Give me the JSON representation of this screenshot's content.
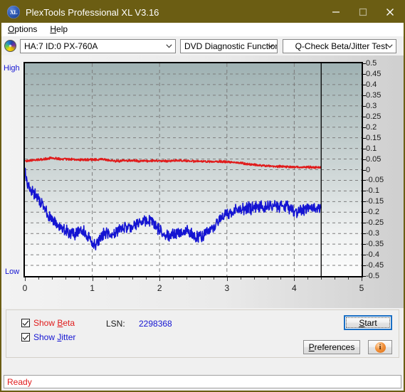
{
  "window": {
    "title": "PlexTools Professional XL V3.16",
    "app_icon": "xl-disc-icon",
    "minimize_label": "minimize-icon",
    "maximize_label": "maximize-icon",
    "close_label": "close-icon",
    "titlebar_color": "#6b5d13"
  },
  "menu": {
    "items": [
      {
        "label": "Options",
        "accel": "O"
      },
      {
        "label": "Help",
        "accel": "H"
      }
    ]
  },
  "toolbar": {
    "drive_icon": "optical-disc-icon",
    "drive_combo": "HA:7 ID:0  PX-760A",
    "function_combo": "DVD Diagnostic Functions",
    "test_combo": "Q-Check Beta/Jitter Test"
  },
  "chart_axis": {
    "top_label": "High",
    "bottom_label": "Low",
    "label_color": "#1414d2"
  },
  "controls": {
    "show_beta_label": "Show Beta",
    "show_beta_checked": true,
    "show_beta_color": "#e01b1b",
    "show_jitter_label": "Show Jitter",
    "show_jitter_checked": true,
    "show_jitter_color": "#1414d2",
    "lsn_label": "LSN:",
    "lsn_value": "2298368",
    "start_label": "Start",
    "preferences_label": "Preferences",
    "info_label": "i"
  },
  "status": {
    "text": "Ready",
    "color": "#e01b1b"
  },
  "chart_data": {
    "type": "line",
    "title": "Q-Check Beta/Jitter Test",
    "xlabel": "",
    "ylabel": "",
    "xlim": [
      0,
      5
    ],
    "ylim": [
      -0.5,
      0.5
    ],
    "grid": true,
    "legend": "none",
    "xticks": [
      0,
      1,
      2,
      3,
      4,
      5
    ],
    "yticks": [
      0.5,
      0.45,
      0.4,
      0.35,
      0.3,
      0.25,
      0.2,
      0.15,
      0.1,
      0.05,
      0,
      -0.05,
      -0.1,
      -0.15,
      -0.2,
      -0.25,
      -0.3,
      -0.35,
      -0.4,
      -0.45,
      -0.5
    ],
    "ytick_labels": [
      "0.5",
      "0.45",
      "0.4",
      "0.35",
      "0.3",
      "0.25",
      "0.2",
      "0.15",
      "0.1",
      "0.05",
      "0",
      "-0.05",
      "-0.1",
      "-0.15",
      "-0.2",
      "-0.25",
      "-0.3",
      "-0.35",
      "-0.4",
      "-0.45",
      "-0.5"
    ],
    "data_end_x": 4.4,
    "marker_line_x": 4.4,
    "marker_line_color": "#000000",
    "plot_bg_top": "#9fb2b3",
    "plot_bg_bottom": "#fdfdfd",
    "gridline_color": "#7d7d7d",
    "series": [
      {
        "name": "Beta",
        "color": "#e01b1b",
        "noise": 0.004,
        "x": [
          0.0,
          0.1,
          0.2,
          0.3,
          0.38,
          0.45,
          0.55,
          0.65,
          0.75,
          0.85,
          0.95,
          1.05,
          1.15,
          1.25,
          1.33,
          1.4,
          1.5,
          1.6,
          1.7,
          1.8,
          1.9,
          2.0,
          2.1,
          2.2,
          2.3,
          2.4,
          2.5,
          2.6,
          2.7,
          2.8,
          2.9,
          3.0,
          3.1,
          3.2,
          3.3,
          3.4,
          3.5,
          3.6,
          3.7,
          3.8,
          3.9,
          4.0,
          4.1,
          4.2,
          4.3,
          4.4
        ],
        "y": [
          0.04,
          0.044,
          0.047,
          0.05,
          0.055,
          0.053,
          0.05,
          0.049,
          0.048,
          0.047,
          0.047,
          0.046,
          0.05,
          0.044,
          0.041,
          0.04,
          0.042,
          0.043,
          0.041,
          0.041,
          0.043,
          0.042,
          0.041,
          0.042,
          0.044,
          0.041,
          0.04,
          0.04,
          0.039,
          0.038,
          0.038,
          0.037,
          0.035,
          0.031,
          0.027,
          0.023,
          0.02,
          0.018,
          0.016,
          0.015,
          0.014,
          0.013,
          0.012,
          0.012,
          0.011,
          0.011
        ]
      },
      {
        "name": "Jitter",
        "color": "#1414d2",
        "noise": 0.022,
        "x": [
          0.0,
          0.03,
          0.06,
          0.09,
          0.12,
          0.16,
          0.2,
          0.24,
          0.28,
          0.32,
          0.36,
          0.4,
          0.44,
          0.48,
          0.52,
          0.56,
          0.6,
          0.64,
          0.68,
          0.72,
          0.76,
          0.8,
          0.84,
          0.88,
          0.92,
          0.96,
          1.0,
          1.04,
          1.08,
          1.12,
          1.16,
          1.2,
          1.25,
          1.3,
          1.35,
          1.4,
          1.45,
          1.5,
          1.55,
          1.6,
          1.65,
          1.7,
          1.75,
          1.8,
          1.85,
          1.9,
          1.95,
          2.0,
          2.05,
          2.1,
          2.15,
          2.2,
          2.25,
          2.3,
          2.35,
          2.4,
          2.45,
          2.5,
          2.55,
          2.6,
          2.65,
          2.7,
          2.75,
          2.8,
          2.85,
          2.9,
          2.95,
          3.0,
          3.05,
          3.1,
          3.15,
          3.2,
          3.25,
          3.3,
          3.35,
          3.4,
          3.45,
          3.5,
          3.55,
          3.6,
          3.65,
          3.7,
          3.75,
          3.8,
          3.85,
          3.9,
          3.95,
          4.0,
          4.05,
          4.1,
          4.15,
          4.2,
          4.25,
          4.3,
          4.35,
          4.4
        ],
        "y": [
          -0.015,
          -0.055,
          -0.075,
          -0.09,
          -0.105,
          -0.125,
          -0.14,
          -0.155,
          -0.175,
          -0.195,
          -0.215,
          -0.225,
          -0.235,
          -0.25,
          -0.26,
          -0.272,
          -0.282,
          -0.295,
          -0.3,
          -0.305,
          -0.3,
          -0.295,
          -0.285,
          -0.295,
          -0.31,
          -0.33,
          -0.35,
          -0.355,
          -0.34,
          -0.32,
          -0.305,
          -0.3,
          -0.305,
          -0.315,
          -0.3,
          -0.285,
          -0.275,
          -0.27,
          -0.268,
          -0.268,
          -0.26,
          -0.25,
          -0.24,
          -0.238,
          -0.24,
          -0.25,
          -0.265,
          -0.285,
          -0.3,
          -0.31,
          -0.312,
          -0.305,
          -0.3,
          -0.295,
          -0.292,
          -0.29,
          -0.295,
          -0.305,
          -0.315,
          -0.32,
          -0.31,
          -0.295,
          -0.28,
          -0.265,
          -0.25,
          -0.235,
          -0.22,
          -0.21,
          -0.202,
          -0.195,
          -0.19,
          -0.188,
          -0.185,
          -0.182,
          -0.18,
          -0.178,
          -0.175,
          -0.172,
          -0.17,
          -0.168,
          -0.166,
          -0.168,
          -0.172,
          -0.175,
          -0.172,
          -0.168,
          -0.19,
          -0.2,
          -0.195,
          -0.188,
          -0.185,
          -0.182,
          -0.183,
          -0.185,
          -0.186,
          -0.185
        ]
      }
    ]
  }
}
